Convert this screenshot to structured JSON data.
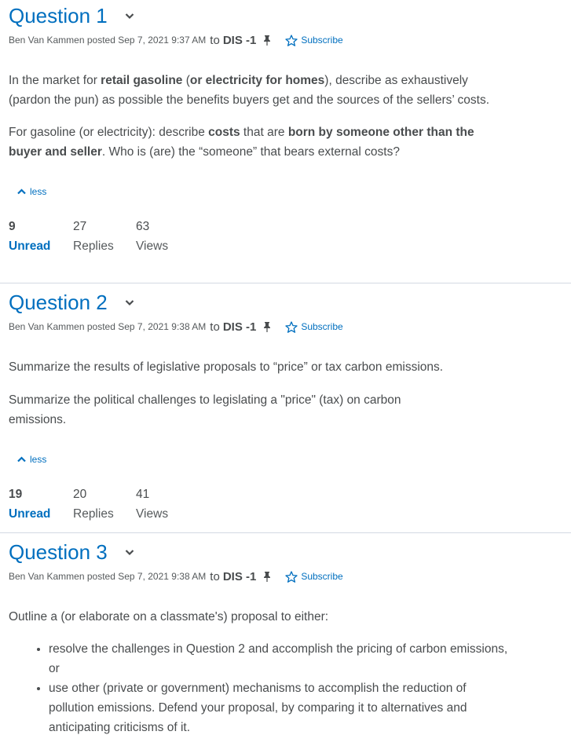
{
  "questions": [
    {
      "title": "Question 1",
      "author": "Ben Van Kammen",
      "posted": "posted Sep 7, 2021 9:37 AM",
      "to_word": "to",
      "group": "DIS -1",
      "subscribe_label": "Subscribe",
      "p1_a": "In the market for ",
      "p1_b": "retail gasoline",
      "p1_c": " (",
      "p1_d": "or electricity for homes",
      "p1_e": "), describe as exhaustively (pardon the pun) as possible the benefits buyers get and the sources of the sellers’ costs.",
      "p2_a": "For gasoline (or electricity):  describe ",
      "p2_b": "costs",
      "p2_c": " that are ",
      "p2_d": "born by someone other than the buyer and seller",
      "p2_e": ".  Who is (are) the “someone” that bears external costs?",
      "less_label": "less",
      "unread_count": "9",
      "unread_label": "Unread",
      "replies_count": "27",
      "replies_label": "Replies",
      "views_count": "63",
      "views_label": "Views"
    },
    {
      "title": "Question 2",
      "author": "Ben Van Kammen",
      "posted": "posted Sep 7, 2021 9:38 AM",
      "to_word": "to",
      "group": "DIS -1",
      "subscribe_label": "Subscribe",
      "p1": "Summarize the results of legislative proposals to “price” or tax carbon emissions.",
      "p2": "Summarize the political challenges to legislating a \"price\" (tax) on carbon emissions.",
      "less_label": "less",
      "unread_count": "19",
      "unread_label": "Unread",
      "replies_count": "20",
      "replies_label": "Replies",
      "views_count": "41",
      "views_label": "Views"
    },
    {
      "title": "Question 3",
      "author": "Ben Van Kammen",
      "posted": "posted Sep 7, 2021 9:38 AM",
      "to_word": "to",
      "group": "DIS -1",
      "subscribe_label": "Subscribe",
      "p1": "Outline a (or elaborate on a classmate's) proposal to either:",
      "bullets": [
        "resolve the challenges in Question 2 and accomplish the pricing of carbon emissions, or",
        "use other (private or government) mechanisms to accomplish the reduction of pollution emissions.  Defend your proposal, by comparing it to alternatives and anticipating criticisms of it."
      ]
    }
  ],
  "colors": {
    "link": "#006fbf",
    "text": "#494c4e",
    "divider": "#d3d9e3"
  },
  "icons": [
    "chevron-down-icon",
    "pin-icon",
    "star-icon",
    "chevron-up-icon"
  ]
}
